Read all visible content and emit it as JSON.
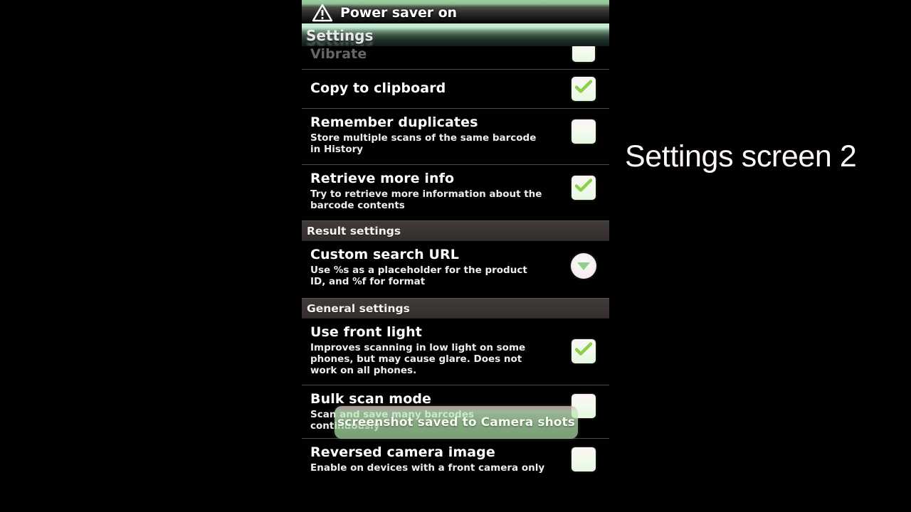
{
  "caption": "Settings screen 2",
  "statusbar": {
    "icon": "power-saver-warning-icon",
    "text": "Power saver on"
  },
  "titlebar": {
    "title": "Settings"
  },
  "toast": {
    "message": "screenshot saved to Camera shots"
  },
  "colors": {
    "screen_background": "#000000",
    "statusbar_accent": "#9fd0a3",
    "titlebar_accent": "#c8f0d8",
    "section_header": "#3a3533",
    "checkbox_face": "#f3fbef",
    "check_green": "#8cd04a",
    "spinner_triangle": "#84c878",
    "toast_background": "#b2e2ac",
    "divider": "#4a4a4a",
    "text_primary": "#ffffff",
    "text_secondary": "#ededed",
    "text_disabled": "#8e8e8e"
  },
  "rows": [
    {
      "name": "vibrate",
      "title": "Vibrate",
      "summary": "",
      "widget": "checkbox",
      "checked": false,
      "state": "ghost"
    },
    {
      "name": "copy-to-clipboard",
      "title": "Copy to clipboard",
      "summary": "",
      "widget": "checkbox",
      "checked": true,
      "state": "normal"
    },
    {
      "name": "remember-duplicates",
      "title": "Remember duplicates",
      "summary": "Store multiple scans of the same barcode in History",
      "widget": "checkbox",
      "checked": false,
      "state": "normal"
    },
    {
      "name": "retrieve-more-info",
      "title": "Retrieve more info",
      "summary": "Try to retrieve more information about the barcode contents",
      "widget": "checkbox",
      "checked": true,
      "state": "normal"
    }
  ],
  "sections": [
    {
      "name": "result-settings",
      "label": "Result settings",
      "rows": [
        {
          "name": "custom-search-url",
          "title": "Custom search URL",
          "summary": "Use %s as a placeholder for the product ID, and %f for format",
          "widget": "spinner",
          "checked": false,
          "state": "normal"
        }
      ]
    },
    {
      "name": "general-settings",
      "label": "General settings",
      "rows": [
        {
          "name": "use-front-light",
          "title": "Use front light",
          "summary": "Improves scanning in low light on some phones, but may cause glare. Does not work on all phones.",
          "widget": "checkbox",
          "checked": true,
          "state": "normal"
        },
        {
          "name": "bulk-scan-mode",
          "title": "Bulk scan mode",
          "summary": "Scan and save many barcodes continuously",
          "widget": "checkbox",
          "checked": false,
          "state": "normal"
        },
        {
          "name": "reversed-camera-image",
          "title": "Reversed camera image",
          "summary": "Enable on devices with a front camera only",
          "widget": "checkbox",
          "checked": false,
          "state": "normal"
        }
      ]
    }
  ]
}
